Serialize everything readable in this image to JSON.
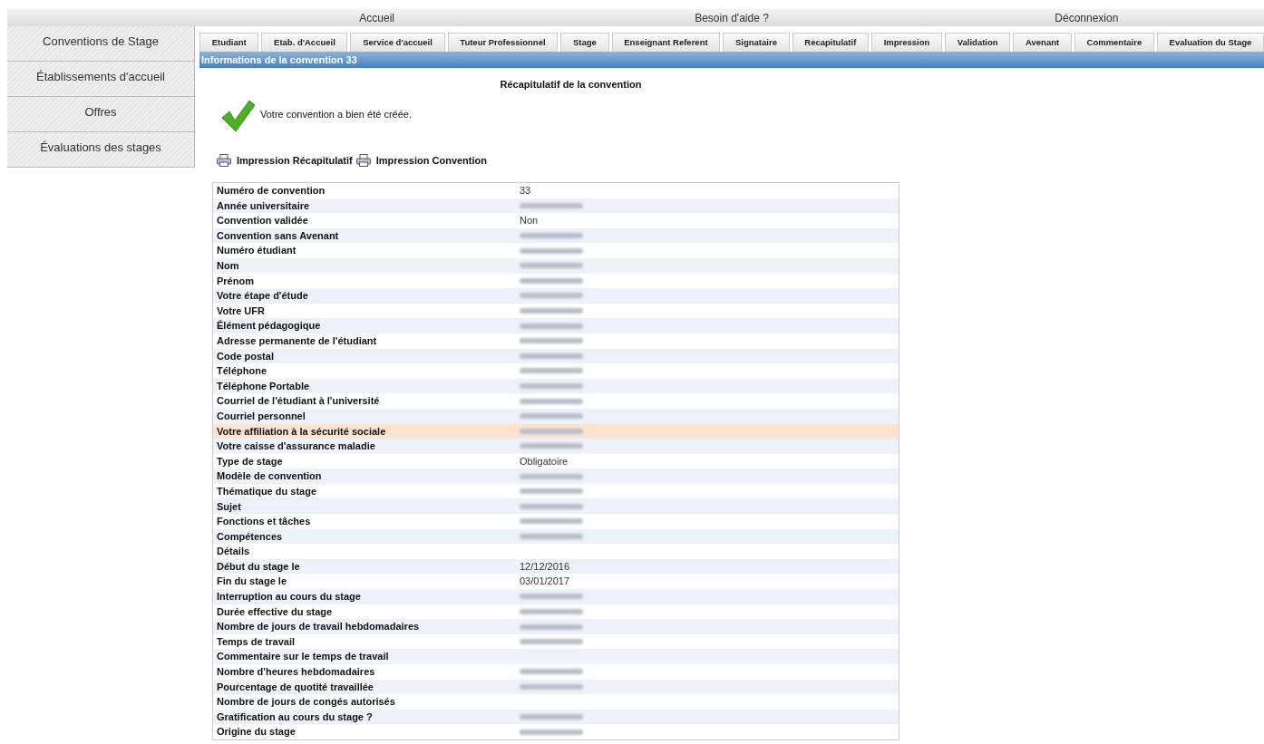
{
  "top_menu": [
    "Accueil",
    "Besoin d'aide ?",
    "Déconnexion"
  ],
  "sidebar": {
    "items": [
      "Conventions de Stage",
      "Établissements d'accueil",
      "Offres",
      "Évaluations des stages"
    ]
  },
  "tabs": [
    "Etudiant",
    "Etab. d'Accueil",
    "Service d'accueil",
    "Tuteur Professionnel",
    "Stage",
    "Enseignant Referent",
    "Signataire",
    "Recapitulatif",
    "Impression",
    "Validation",
    "Avenant",
    "Commentaire",
    "Evaluation du Stage"
  ],
  "panel_title": "Informations de la convention 33",
  "recap_title": "Récapitulatif de la convention",
  "success_message": "Votre convention a bien été créée.",
  "print_links": [
    "Impression Récapitulatif",
    "Impression Convention"
  ],
  "rows": [
    {
      "label": "Numéro de convention",
      "kind": "text",
      "value": "33",
      "highlighted": false
    },
    {
      "label": "Année universitaire",
      "kind": "redacted",
      "highlighted": false
    },
    {
      "label": "Convention validée",
      "kind": "text",
      "value": "Non",
      "highlighted": false
    },
    {
      "label": "Convention sans Avenant",
      "kind": "redacted",
      "highlighted": false
    },
    {
      "label": "Numéro étudiant",
      "kind": "redacted",
      "highlighted": false
    },
    {
      "label": "Nom",
      "kind": "redacted",
      "highlighted": false
    },
    {
      "label": "Prénom",
      "kind": "redacted",
      "highlighted": false
    },
    {
      "label": "Votre étape d'étude",
      "kind": "redacted",
      "highlighted": false
    },
    {
      "label": "Votre UFR",
      "kind": "redacted",
      "highlighted": false
    },
    {
      "label": "Élément pédagogique",
      "kind": "redacted",
      "highlighted": false
    },
    {
      "label": "Adresse permanente de l'étudiant",
      "kind": "redacted",
      "highlighted": false
    },
    {
      "label": "Code postal",
      "kind": "redacted",
      "highlighted": false
    },
    {
      "label": "Téléphone",
      "kind": "redacted",
      "highlighted": false
    },
    {
      "label": "Téléphone Portable",
      "kind": "redacted",
      "highlighted": false
    },
    {
      "label": "Courriel de l'étudiant à l'université",
      "kind": "redacted",
      "highlighted": false
    },
    {
      "label": "Courriel personnel",
      "kind": "redacted",
      "highlighted": false
    },
    {
      "label": "Votre affiliation à la sécurité sociale",
      "kind": "redacted",
      "highlighted": true
    },
    {
      "label": "Votre caisse d'assurance maladie",
      "kind": "redacted",
      "highlighted": false
    },
    {
      "label": "Type de stage",
      "kind": "text",
      "value": "Obligatoire",
      "highlighted": false
    },
    {
      "label": "Modèle de convention",
      "kind": "redacted",
      "highlighted": false
    },
    {
      "label": "Thématique du stage",
      "kind": "redacted",
      "highlighted": false
    },
    {
      "label": "Sujet",
      "kind": "redacted",
      "highlighted": false
    },
    {
      "label": "Fonctions et tâches",
      "kind": "redacted",
      "highlighted": false
    },
    {
      "label": "Compétences",
      "kind": "redacted",
      "highlighted": false
    },
    {
      "label": "Détails",
      "kind": "empty",
      "highlighted": false
    },
    {
      "label": "Début du stage le",
      "kind": "text",
      "value": "12/12/2016",
      "highlighted": false
    },
    {
      "label": "Fin du stage le",
      "kind": "text",
      "value": "03/01/2017",
      "highlighted": false
    },
    {
      "label": "Interruption au cours du stage",
      "kind": "redacted",
      "highlighted": false
    },
    {
      "label": "Durée effective du stage",
      "kind": "redacted",
      "highlighted": false
    },
    {
      "label": "Nombre de jours de travail hebdomadaires",
      "kind": "redacted",
      "highlighted": false
    },
    {
      "label": "Temps de travail",
      "kind": "redacted",
      "highlighted": false
    },
    {
      "label": "Commentaire sur le temps de travail",
      "kind": "empty",
      "highlighted": false
    },
    {
      "label": "Nombre d'heures hebdomadaires",
      "kind": "redacted",
      "highlighted": false
    },
    {
      "label": "Pourcentage de quotité travaillée",
      "kind": "redacted",
      "highlighted": false
    },
    {
      "label": "Nombre de jours de congés autorisés",
      "kind": "empty",
      "highlighted": false
    },
    {
      "label": "Gratification au cours du stage ?",
      "kind": "redacted",
      "highlighted": false
    },
    {
      "label": "Origine du stage",
      "kind": "redacted",
      "highlighted": false
    }
  ]
}
